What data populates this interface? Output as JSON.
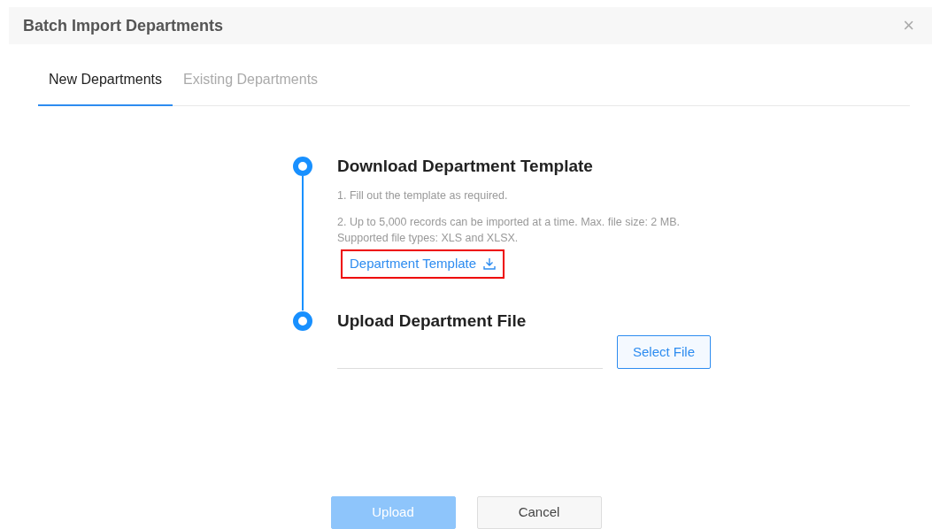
{
  "dialog": {
    "title": "Batch Import Departments",
    "close": "×"
  },
  "tabs": [
    {
      "label": "New Departments",
      "selected": true
    },
    {
      "label": "Existing Departments",
      "selected": false
    }
  ],
  "steps": [
    {
      "title": "Download Department Template",
      "lines": [
        "1. Fill out the template as required.",
        "2. Up to 5,000 records can be imported at a time. Max. file size: 2 MB.\nSupported file types: XLS and XLSX."
      ],
      "link": {
        "label": "Department Template",
        "highlighted": true
      }
    },
    {
      "title": "Upload Department File",
      "file_button": "Select File"
    }
  ],
  "buttons": [
    {
      "label": "Upload",
      "kind": "primary",
      "disabled": true
    },
    {
      "label": "Cancel",
      "kind": "secondary",
      "disabled": false
    }
  ]
}
